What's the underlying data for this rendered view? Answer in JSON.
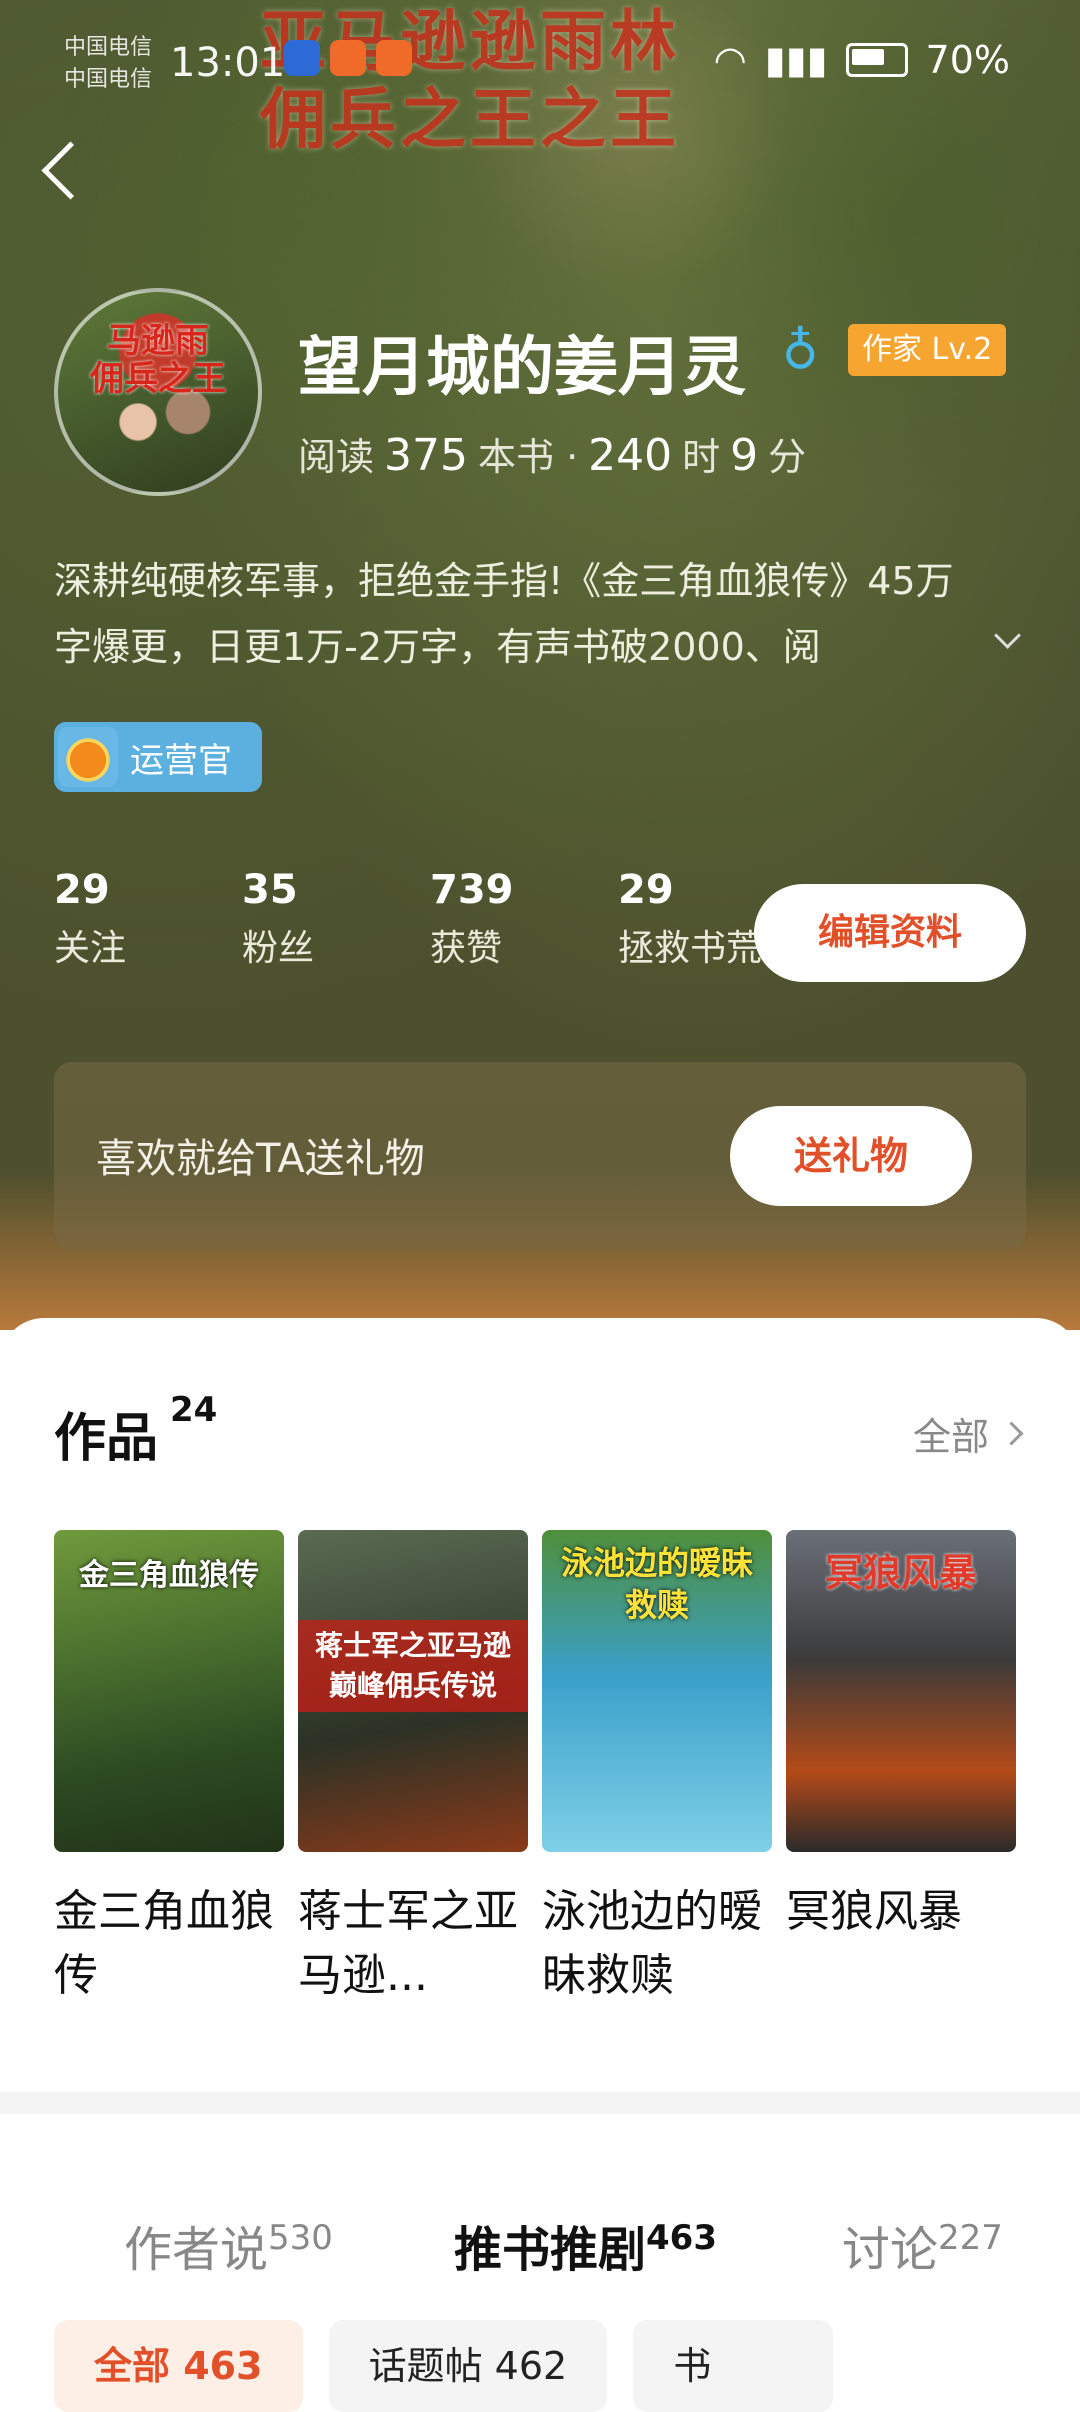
{
  "status_bar": {
    "carrier_1": "中国电信",
    "carrier_2": "中国电信",
    "time": "13:01",
    "battery": "70%"
  },
  "banner": {
    "title_line1": "亚马逊逊雨林",
    "title_line2": "佣兵之王之王"
  },
  "profile": {
    "avatar_text_line1": "马逊雨",
    "avatar_text_line2": "佣兵之王",
    "username": "望月城的姜月灵",
    "level_badge": "作家 Lv.2",
    "read_prefix": "阅读",
    "read_books": "375",
    "read_books_unit": "本书 ·",
    "read_hours": "240",
    "read_hours_unit": "时",
    "read_minutes": "9",
    "read_minutes_unit": "分",
    "bio_line1": "深耕纯硬核军事，拒绝金手指!《金三角血狼传》45万",
    "bio_line2": "字爆更，日更1万-2万字，有声书破2000、阅",
    "ops_badge": "运营官",
    "stats": [
      {
        "value": "29",
        "label": "关注"
      },
      {
        "value": "35",
        "label": "粉丝"
      },
      {
        "value": "739",
        "label": "获赞"
      },
      {
        "value": "29",
        "label": "拯救书荒"
      }
    ],
    "edit_button": "编辑资料"
  },
  "gift": {
    "text": "喜欢就给TA送礼物",
    "button": "送礼物"
  },
  "works": {
    "title": "作品",
    "count": "24",
    "see_all": "全部",
    "books": [
      {
        "cover_title": "金三角血狼传",
        "name": "金三角血狼传",
        "color": "#3f6b32"
      },
      {
        "cover_title": "蒋士军之亚马逊巅峰佣兵传说",
        "name": "蒋士军之亚马逊...",
        "color": "#2f3a2c"
      },
      {
        "cover_title": "泳池边的暧昧救赎",
        "name": "泳池边的暧昧救赎",
        "color": "#3aa0c9"
      },
      {
        "cover_title": "冥狼风暴",
        "name": "冥狼风暴",
        "color": "#4a4a4a"
      }
    ]
  },
  "tabs": [
    {
      "label": "作者说",
      "count": "530"
    },
    {
      "label": "推书推剧",
      "count": "463"
    },
    {
      "label": "讨论",
      "count": "227"
    }
  ],
  "chips": [
    {
      "label": "全部 463"
    },
    {
      "label": "话题帖 462"
    },
    {
      "label": "书"
    }
  ],
  "colors": {
    "accent": "#e2502a",
    "level_badge": "#f7a531",
    "header_bg": "#4c5532"
  }
}
